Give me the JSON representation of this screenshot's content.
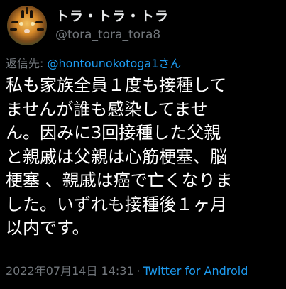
{
  "user": {
    "display_name": "トラ・トラ・トラ",
    "handle": "@tora_tora_tora8"
  },
  "reply": {
    "prefix": "返信先: ",
    "mention": "@hontounokotoga1さん"
  },
  "tweet": {
    "lines": [
      "私も家族全員１度も接種して",
      "ませんが誰も感染してませ",
      "ん。因みに3回接種した父親",
      "と親戚は父親は心筋梗塞、脳",
      "梗塞 、親戚は癌で亡くなりま",
      "した。いずれも接種後１ヶ月",
      "以内です。"
    ]
  },
  "meta": {
    "timestamp": "2022年07月14日 14:31",
    "separator": "·",
    "source": "Twitter for Android"
  },
  "colors": {
    "background": "#000000",
    "text": "#ffffff",
    "secondary": "#71767b",
    "accent": "#1d9bf0"
  },
  "icons": {
    "avatar": "tiger-avatar-icon"
  }
}
